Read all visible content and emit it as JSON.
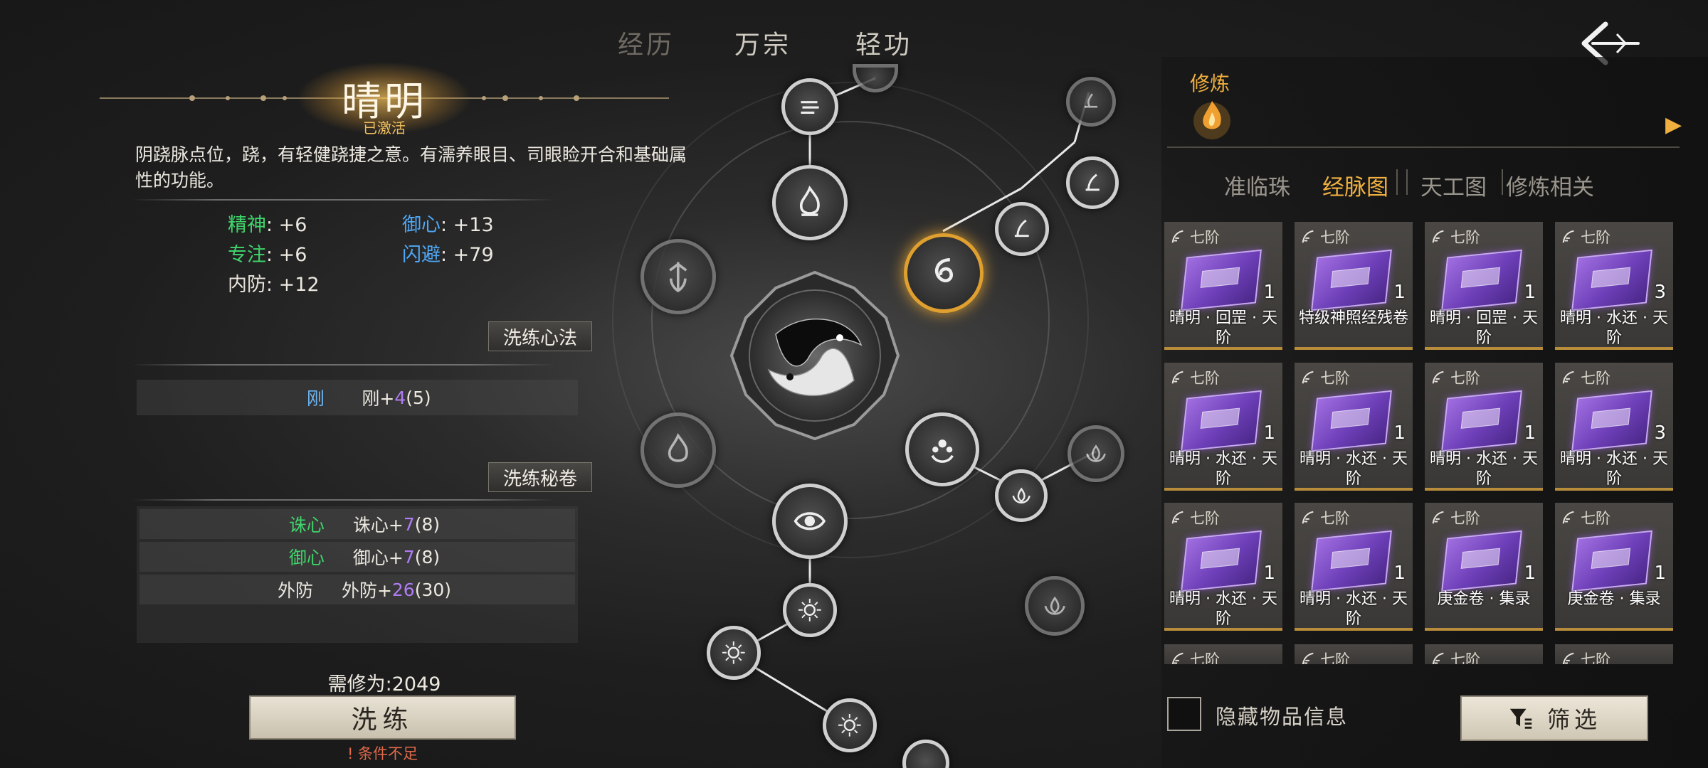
{
  "top_tabs": [
    {
      "label": "经历",
      "state": "faded"
    },
    {
      "label": "万宗",
      "state": "normal"
    },
    {
      "label": "轻功",
      "state": "normal"
    }
  ],
  "meridian": {
    "name": "晴明",
    "status": "已激活",
    "description": "阴跷脉点位，跷，有轻健跷捷之意。有濡养眼目、司眼睑开合和基础属性的功能。"
  },
  "stats": [
    {
      "key": "精神",
      "value": ": +6",
      "color": "#3fd46a"
    },
    {
      "key": "御心",
      "value": ": +13",
      "color": "#4fa7f5"
    },
    {
      "key": "专注",
      "value": ": +6",
      "color": "#3fd46a"
    },
    {
      "key": "闪避",
      "value": ": +79",
      "color": "#4fa7f5"
    },
    {
      "key": "内防",
      "value": ": +12",
      "color": "#e8e4dc"
    }
  ],
  "xinfa": {
    "button": "洗练心法",
    "rows": [
      {
        "name": "刚",
        "label": "刚+",
        "val": "4",
        "max": "(5)",
        "name_color": "#6cb6f5"
      }
    ]
  },
  "mijuan": {
    "button": "洗练秘卷",
    "rows": [
      {
        "name": "诛心",
        "label": "诛心+",
        "val": "7",
        "max": "(8)",
        "name_color": "#3fd46a"
      },
      {
        "name": "御心",
        "label": "御心+",
        "val": "7",
        "max": "(8)",
        "name_color": "#3fd46a"
      },
      {
        "name": "外防",
        "label": "外防+",
        "val": "26",
        "max": "(30)",
        "name_color": "#ece8e0"
      }
    ]
  },
  "cost_text": "需修为:2049",
  "refine_button": "洗练",
  "warning": "条件不足",
  "right": {
    "section_title": "修炼",
    "sub_tabs": [
      "准临珠",
      "经脉图",
      "天工图",
      "修炼相关"
    ],
    "active_tab": 1,
    "items": [
      {
        "rank": "七阶",
        "count": "1",
        "name": "晴明 · 回罡 · 天阶"
      },
      {
        "rank": "七阶",
        "count": "1",
        "name": "特级神照经残卷"
      },
      {
        "rank": "七阶",
        "count": "1",
        "name": "晴明 · 回罡 · 天阶"
      },
      {
        "rank": "七阶",
        "count": "3",
        "name": "晴明 · 水还 · 天阶"
      },
      {
        "rank": "七阶",
        "count": "1",
        "name": "晴明 · 水还 · 天阶"
      },
      {
        "rank": "七阶",
        "count": "1",
        "name": "晴明 · 水还 · 天阶"
      },
      {
        "rank": "七阶",
        "count": "1",
        "name": "晴明 · 水还 · 天阶"
      },
      {
        "rank": "七阶",
        "count": "3",
        "name": "晴明 · 水还 · 天阶"
      },
      {
        "rank": "七阶",
        "count": "1",
        "name": "晴明 · 水还 · 天阶"
      },
      {
        "rank": "七阶",
        "count": "1",
        "name": "晴明 · 水还 · 天阶"
      },
      {
        "rank": "七阶",
        "count": "1",
        "name": "庚金卷 · 集录"
      },
      {
        "rank": "七阶",
        "count": "1",
        "name": "庚金卷 · 集录"
      }
    ],
    "partial_items": [
      "七阶",
      "七阶",
      "七阶",
      "七阶"
    ],
    "hide_info_label": "隐藏物品信息",
    "filter_button": "筛选"
  }
}
